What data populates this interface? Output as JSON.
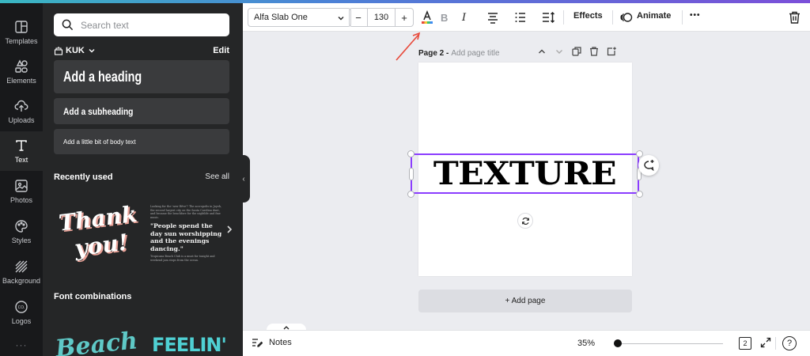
{
  "rail": {
    "items": [
      {
        "label": "Templates",
        "icon": "templates-icon"
      },
      {
        "label": "Elements",
        "icon": "elements-icon"
      },
      {
        "label": "Uploads",
        "icon": "uploads-icon"
      },
      {
        "label": "Text",
        "icon": "text-icon"
      },
      {
        "label": "Photos",
        "icon": "photos-icon"
      },
      {
        "label": "Styles",
        "icon": "styles-icon"
      },
      {
        "label": "Background",
        "icon": "background-icon"
      },
      {
        "label": "Logos",
        "icon": "logos-icon"
      }
    ],
    "active": "Text",
    "more": "···"
  },
  "panel": {
    "search_placeholder": "Search text",
    "kit_name": "KUK",
    "kit_edit": "Edit",
    "add_heading": "Add a heading",
    "add_subheading": "Add a subheading",
    "add_body": "Add a little bit of body text",
    "recently_used": "Recently used",
    "see_all": "See all",
    "tile_thank_line1": "Thank",
    "tile_thank_line2": "you!",
    "tile_people_intro": "Looking for the 'new Rêve'? The accropolis in Joyeh, the second largest city on the Santa Carolina dunt, and became the beachfore for the nightlife and fine music.",
    "tile_people_quote": "\"People spend the day sun worshipping and the evenings dancing.\"",
    "tile_people_outro": "Tropicana Beach Club is a must for tonight and weekend jam stops from the ocean.",
    "font_combinations": "Font combinations",
    "tile_beach": "Beach",
    "tile_feelin": "FEELIN'"
  },
  "toolbar": {
    "font": "Alfa Slab One",
    "size_minus": "−",
    "size": "130",
    "size_plus": "+",
    "bold": "B",
    "italic": "I",
    "effects": "Effects",
    "animate": "Animate",
    "more": "•••"
  },
  "canvas": {
    "page_label": "Page 2 -",
    "page_title_placeholder": "Add page title",
    "text": "TEXTURE",
    "add_page": "+ Add page"
  },
  "bottombar": {
    "notes": "Notes",
    "zoom": "35%",
    "zoom_fraction": 0.0,
    "page_count": "2",
    "help": "?"
  },
  "colors": {
    "accent": "#8b3dff",
    "annotation": "#e84a3b",
    "panel_bg": "#252627",
    "rail_bg": "#18191b"
  }
}
